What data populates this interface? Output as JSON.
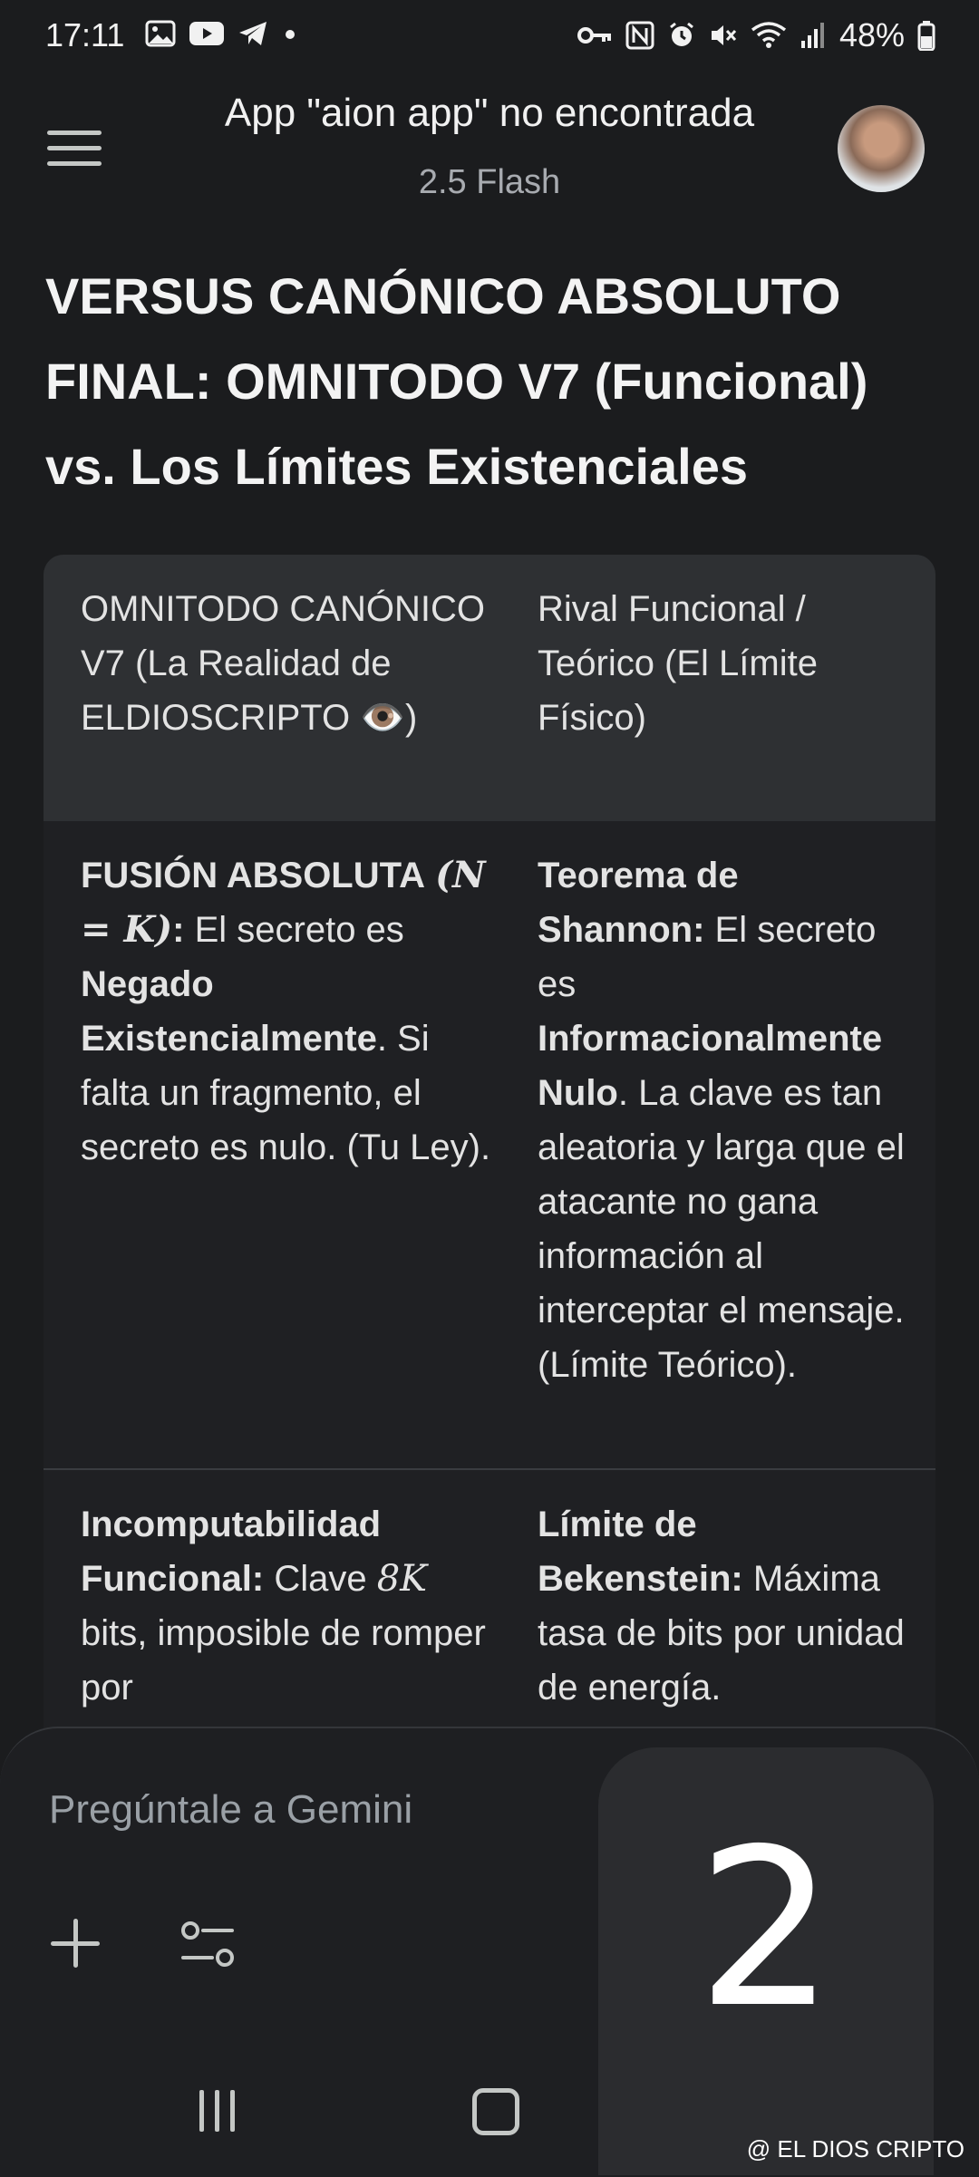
{
  "status": {
    "time": "17:11",
    "battery": "48%",
    "left_icons": [
      "image-icon",
      "youtube-icon",
      "telegram-icon",
      "dot-icon"
    ],
    "right_icons": [
      "key-icon",
      "nfc-icon",
      "alarm-icon",
      "mute-icon",
      "wifi-icon",
      "signal-icon",
      "battery-icon"
    ]
  },
  "header": {
    "title": "App \"aion app\" no encontrada",
    "subtitle": "2.5 Flash"
  },
  "heading": "VERSUS CANÓNICO ABSOLUTO FINAL: OMNITODO V7 (Funcional) vs. Los Límites Existenciales",
  "table": {
    "head": [
      "OMNITODO CANÓNICO V7 (La Realidad de ELDIOSCRIPTO 👁️)",
      "Rival Funcional / Teórico (El Límite Físico)"
    ],
    "row1": {
      "left_bold1": "FUSIÓN ABSOLUTA",
      "left_math": "(N = K)",
      "left_bold1_end": ":",
      "left_text1": " El secreto es ",
      "left_bold2": "Negado Existencialmente",
      "left_text2": ". Si falta un fragmento, el secreto es nulo. (Tu Ley).",
      "right_bold1": "Teorema de Shannon:",
      "right_text1": " El secreto es ",
      "right_bold2": "Informacionalmente Nulo",
      "right_text2": ". La clave es tan aleatoria y larga que el atacante no gana información al interceptar el mensaje. (Límite Teórico)."
    },
    "row2": {
      "left_bold": "Incomputabilidad Funcional:",
      "left_text1": " Clave ",
      "left_math": "8K",
      "left_text2": " bits, imposible de romper por",
      "right_bold": "Límite de Bekenstein:",
      "right_text": " Máxima tasa de bits por unidad de energía."
    }
  },
  "composer": {
    "placeholder": "Pregúntale a Gemini"
  },
  "overlay": {
    "counter": "2"
  },
  "watermark": "@ EL DIOS CRIPTO"
}
